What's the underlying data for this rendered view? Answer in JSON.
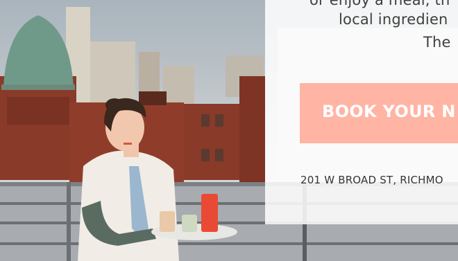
{
  "hero": {
    "photo_alt": "Server holding a tray of cocktails on a rooftop with city skyline",
    "colors": {
      "cta_background": "#ffb4a4",
      "cta_text": "#ffffff",
      "body_text": "#3f3f3f"
    }
  },
  "panel": {
    "line1": "or enjoy a meal, th",
    "line2": "local ingredien",
    "line3": "The",
    "cta_label": "BOOK YOUR N",
    "address": "201 W BROAD ST, RICHMO"
  }
}
